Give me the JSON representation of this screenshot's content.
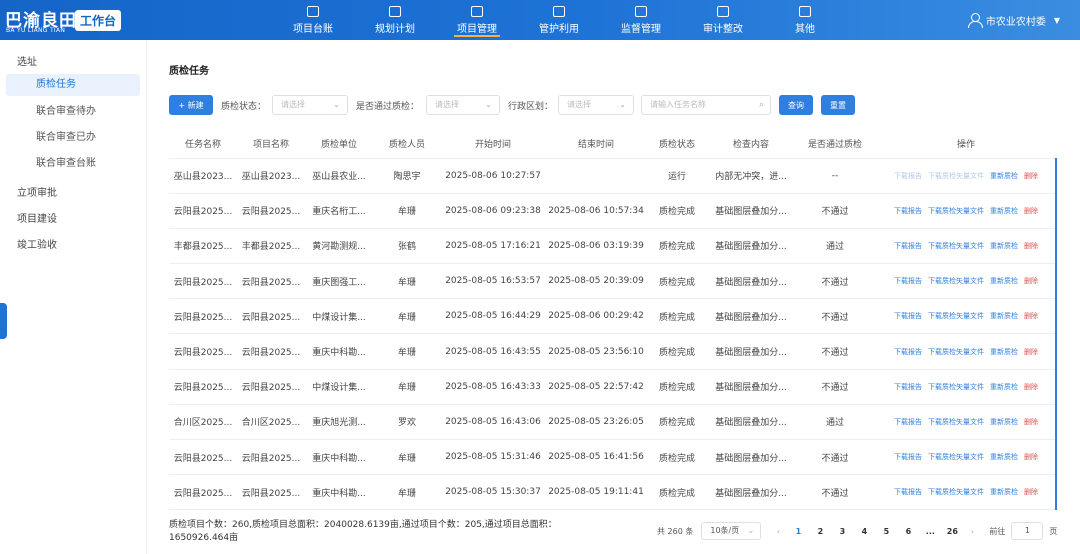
{
  "header": {
    "logo_text": "巴渝良田",
    "logo_pinyin": "BA YU LIANG TIAN",
    "workspace_badge": "工作台",
    "nav": [
      {
        "label": "项目台账",
        "icon": "cube-icon"
      },
      {
        "label": "规划计划",
        "icon": "edit-icon"
      },
      {
        "label": "项目管理",
        "icon": "document-icon",
        "active": true
      },
      {
        "label": "管护利用",
        "icon": "scan-icon"
      },
      {
        "label": "监督管理",
        "icon": "shield-check-icon"
      },
      {
        "label": "审计整改",
        "icon": "clipboard-icon"
      },
      {
        "label": "其他",
        "icon": "grid-icon"
      }
    ],
    "user": "市农业农村委"
  },
  "sidebar": {
    "groups": [
      {
        "label": "选址",
        "items": [
          "质检任务",
          "联合审查待办",
          "联合审查已办",
          "联合审查台账"
        ]
      },
      {
        "label": "立项审批"
      },
      {
        "label": "项目建设"
      },
      {
        "label": "竣工验收"
      }
    ],
    "active_item": "质检任务"
  },
  "main": {
    "title": "质检任务",
    "filters": {
      "new_button": "+ 新建",
      "status_label": "质检状态：",
      "status_placeholder": "请选择",
      "passed_label": "是否通过质检：",
      "passed_placeholder": "请选择",
      "region_label": "行政区划：",
      "region_placeholder": "请选择",
      "name_placeholder": "请输入任务名称",
      "query_button": "查询",
      "reset_button": "重置"
    },
    "table": {
      "headers": [
        "任务名称",
        "项目名称",
        "质检单位",
        "质检人员",
        "开始时间",
        "结束时间",
        "质检状态",
        "检查内容",
        "是否通过质检",
        "操作"
      ],
      "ops": [
        "下载报告",
        "下载质检矢量文件",
        "重新质检",
        "删除"
      ],
      "rows": [
        [
          "巫山县2023...",
          "巫山县2023...",
          "巫山县农业...",
          "陶思宇",
          "2025-08-06 10:27:57",
          "",
          "运行",
          "内部无冲突，进...",
          "--",
          "disabled"
        ],
        [
          "云阳县2025...",
          "云阳县2025...",
          "重庆名桁工...",
          "牟珊",
          "2025-08-06 09:23:38",
          "2025-08-06 10:57:34",
          "质检完成",
          "基础图层叠加分...",
          "不通过",
          "enabled"
        ],
        [
          "丰都县2025...",
          "丰都县2025...",
          "黄河勘测规...",
          "张鹤",
          "2025-08-05 17:16:21",
          "2025-08-06 03:19:39",
          "质检完成",
          "基础图层叠加分...",
          "通过",
          "enabled"
        ],
        [
          "云阳县2025...",
          "云阳县2025...",
          "重庆图强工...",
          "牟珊",
          "2025-08-05 16:53:57",
          "2025-08-05 20:39:09",
          "质检完成",
          "基础图层叠加分...",
          "不通过",
          "enabled"
        ],
        [
          "云阳县2025...",
          "云阳县2025...",
          "中煤设计集...",
          "牟珊",
          "2025-08-05 16:44:29",
          "2025-08-06 00:29:42",
          "质检完成",
          "基础图层叠加分...",
          "不通过",
          "enabled"
        ],
        [
          "云阳县2025...",
          "云阳县2025...",
          "重庆中科勘...",
          "牟珊",
          "2025-08-05 16:43:55",
          "2025-08-05 23:56:10",
          "质检完成",
          "基础图层叠加分...",
          "不通过",
          "enabled"
        ],
        [
          "云阳县2025...",
          "云阳县2025...",
          "中煤设计集...",
          "牟珊",
          "2025-08-05 16:43:33",
          "2025-08-05 22:57:42",
          "质检完成",
          "基础图层叠加分...",
          "不通过",
          "enabled"
        ],
        [
          "合川区2025...",
          "合川区2025...",
          "重庆旭光测...",
          "罗欢",
          "2025-08-05 16:43:06",
          "2025-08-05 23:26:05",
          "质检完成",
          "基础图层叠加分...",
          "通过",
          "enabled"
        ],
        [
          "云阳县2025...",
          "云阳县2025...",
          "重庆中科勘...",
          "牟珊",
          "2025-08-05 15:31:46",
          "2025-08-05 16:41:56",
          "质检完成",
          "基础图层叠加分...",
          "不通过",
          "enabled"
        ],
        [
          "云阳县2025...",
          "云阳县2025...",
          "重庆中科勘...",
          "牟珊",
          "2025-08-05 15:30:37",
          "2025-08-05 19:11:41",
          "质检完成",
          "基础图层叠加分...",
          "不通过",
          "enabled"
        ]
      ]
    },
    "summary": "质检项目个数：260,质检项目总面积：2040028.6139亩,通过项目个数：205,通过项目总面积：1650926.464亩",
    "pagination": {
      "total": "共 260 条",
      "page_size": "10条/页",
      "prev": "‹",
      "pages": [
        "1",
        "2",
        "3",
        "4",
        "5",
        "6",
        "...",
        "26"
      ],
      "current": "1",
      "next": "›",
      "goto_label": "前往",
      "goto_value": "1",
      "goto_suffix": "页"
    }
  },
  "colors": {
    "primary": "#2f7fe0",
    "header": "#1565c8",
    "danger": "#e05050",
    "accent": "#ffb13b"
  }
}
